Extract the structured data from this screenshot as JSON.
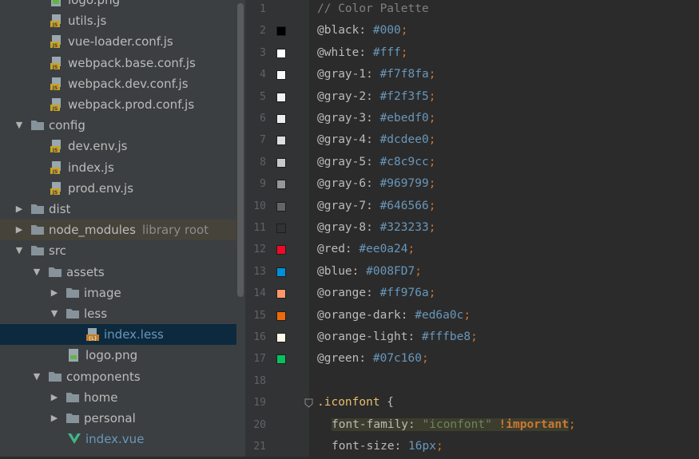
{
  "tree": [
    {
      "label": "logo.png",
      "type": "file-png",
      "indent": 2,
      "arrow": "none"
    },
    {
      "label": "utils.js",
      "type": "file-js",
      "indent": 2,
      "arrow": "none"
    },
    {
      "label": "vue-loader.conf.js",
      "type": "file-js",
      "indent": 2,
      "arrow": "none"
    },
    {
      "label": "webpack.base.conf.js",
      "type": "file-js",
      "indent": 2,
      "arrow": "none"
    },
    {
      "label": "webpack.dev.conf.js",
      "type": "file-js",
      "indent": 2,
      "arrow": "none"
    },
    {
      "label": "webpack.prod.conf.js",
      "type": "file-js",
      "indent": 2,
      "arrow": "none"
    },
    {
      "label": "config",
      "type": "folder",
      "indent": 1,
      "arrow": "down"
    },
    {
      "label": "dev.env.js",
      "type": "file-js",
      "indent": 2,
      "arrow": "none"
    },
    {
      "label": "index.js",
      "type": "file-js",
      "indent": 2,
      "arrow": "none"
    },
    {
      "label": "prod.env.js",
      "type": "file-js",
      "indent": 2,
      "arrow": "none"
    },
    {
      "label": "dist",
      "type": "folder",
      "indent": 1,
      "arrow": "right"
    },
    {
      "label": "node_modules",
      "note": "library root",
      "type": "folder",
      "indent": 1,
      "arrow": "right",
      "lib": true
    },
    {
      "label": "src",
      "type": "folder",
      "indent": 1,
      "arrow": "down"
    },
    {
      "label": "assets",
      "type": "folder",
      "indent": 2,
      "arrow": "down"
    },
    {
      "label": "image",
      "type": "folder",
      "indent": 3,
      "arrow": "right"
    },
    {
      "label": "less",
      "type": "folder",
      "indent": 3,
      "arrow": "down"
    },
    {
      "label": "index.less",
      "type": "file-less",
      "indent": 4,
      "arrow": "none",
      "selected": true
    },
    {
      "label": "logo.png",
      "type": "file-png",
      "indent": 3,
      "arrow": "none"
    },
    {
      "label": "components",
      "type": "folder",
      "indent": 2,
      "arrow": "down"
    },
    {
      "label": "home",
      "type": "folder",
      "indent": 3,
      "arrow": "right"
    },
    {
      "label": "personal",
      "type": "folder",
      "indent": 3,
      "arrow": "right"
    },
    {
      "label": "index.vue",
      "type": "file-vue",
      "indent": 3,
      "arrow": "none"
    }
  ],
  "editor": {
    "comment": "// Color Palette",
    "lines": [
      {
        "num": "1",
        "kind": "comment",
        "text": "// Color Palette"
      },
      {
        "num": "2",
        "kind": "var",
        "name": "@black",
        "value": "#000",
        "swatch": "#000000"
      },
      {
        "num": "3",
        "kind": "var",
        "name": "@white",
        "value": "#fff",
        "swatch": "#ffffff"
      },
      {
        "num": "4",
        "kind": "var",
        "name": "@gray-1",
        "value": "#f7f8fa",
        "swatch": "#f7f8fa"
      },
      {
        "num": "5",
        "kind": "var",
        "name": "@gray-2",
        "value": "#f2f3f5",
        "swatch": "#f2f3f5"
      },
      {
        "num": "6",
        "kind": "var",
        "name": "@gray-3",
        "value": "#ebedf0",
        "swatch": "#ebedf0"
      },
      {
        "num": "7",
        "kind": "var",
        "name": "@gray-4",
        "value": "#dcdee0",
        "swatch": "#dcdee0"
      },
      {
        "num": "8",
        "kind": "var",
        "name": "@gray-5",
        "value": "#c8c9cc",
        "swatch": "#c8c9cc"
      },
      {
        "num": "9",
        "kind": "var",
        "name": "@gray-6",
        "value": "#969799",
        "swatch": "#969799"
      },
      {
        "num": "10",
        "kind": "var",
        "name": "@gray-7",
        "value": "#646566",
        "swatch": "#646566"
      },
      {
        "num": "11",
        "kind": "var",
        "name": "@gray-8",
        "value": "#323233",
        "swatch": "#323233"
      },
      {
        "num": "12",
        "kind": "var",
        "name": "@red",
        "value": "#ee0a24",
        "swatch": "#ee0a24"
      },
      {
        "num": "13",
        "kind": "var",
        "name": "@blue",
        "value": "#008FD7",
        "swatch": "#008fd7"
      },
      {
        "num": "14",
        "kind": "var",
        "name": "@orange",
        "value": "#ff976a",
        "swatch": "#ff976a"
      },
      {
        "num": "15",
        "kind": "var",
        "name": "@orange-dark",
        "value": "#ed6a0c",
        "swatch": "#ed6a0c"
      },
      {
        "num": "16",
        "kind": "var",
        "name": "@orange-light",
        "value": "#fffbe8",
        "swatch": "#fffbe8"
      },
      {
        "num": "17",
        "kind": "var",
        "name": "@green",
        "value": "#07c160",
        "swatch": "#07c160"
      },
      {
        "num": "18",
        "kind": "blank"
      },
      {
        "num": "19",
        "kind": "selector",
        "text": ".iconfont",
        "brace": "{"
      },
      {
        "num": "20",
        "kind": "prop",
        "prop": "font-family",
        "str": "\"iconfont\"",
        "imp": "!important"
      },
      {
        "num": "21",
        "kind": "prop2",
        "prop": "font-size",
        "value": "16px"
      }
    ]
  },
  "colors": {
    "folder": "#87939a",
    "js": "#c9a227",
    "vue": "#41b883",
    "accent": "#6897bb"
  }
}
